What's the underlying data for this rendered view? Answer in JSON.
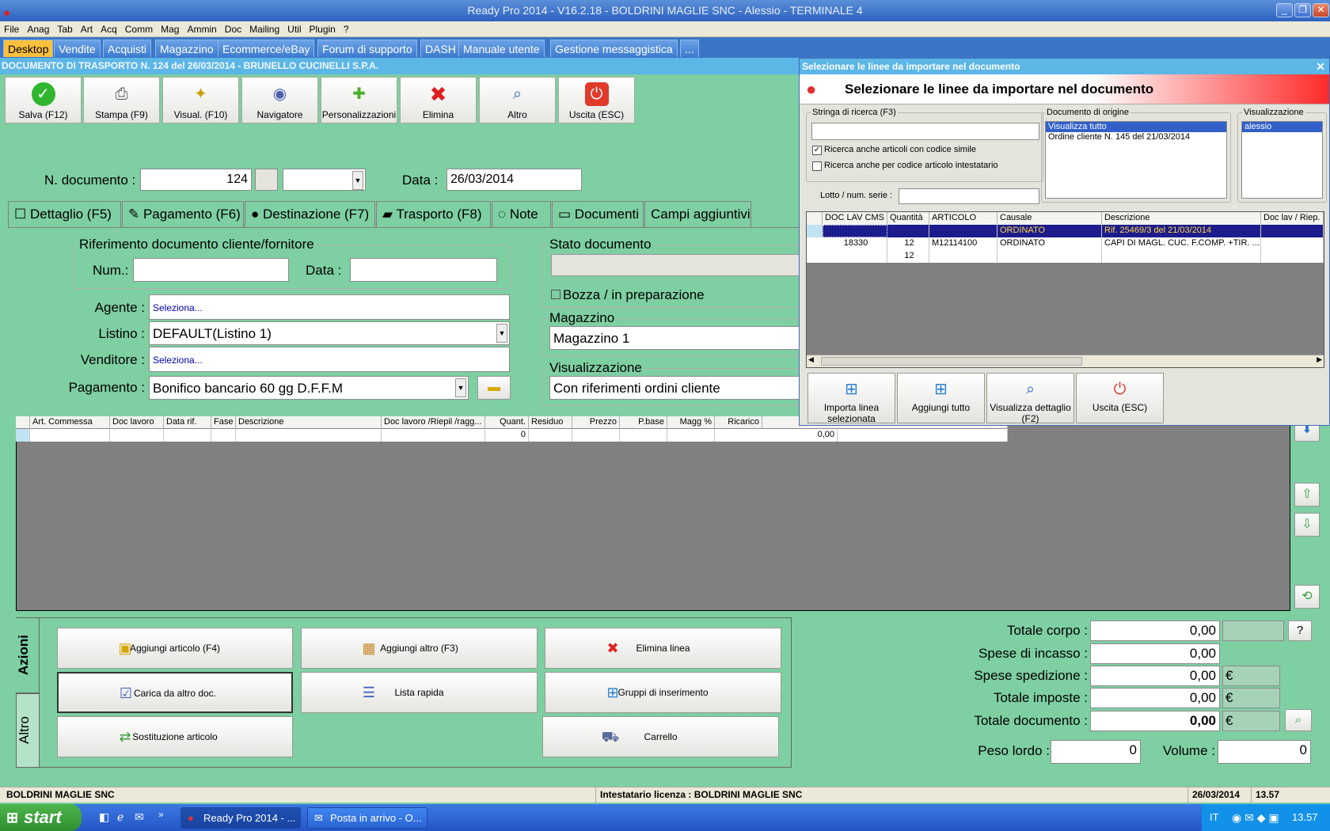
{
  "window": {
    "title": "Ready Pro 2014 - V16.2.18 - BOLDRINI MAGLIE SNC - Alessio - TERMINALE 4",
    "app_icon": "strawberry-icon"
  },
  "menu": [
    "File",
    "Anag",
    "Tab",
    "Art",
    "Acq",
    "Comm",
    "Mag",
    "Ammin",
    "Doc",
    "Mailing",
    "Util",
    "Plugin",
    "?"
  ],
  "main_tabs": [
    "Desktop",
    "Vendite",
    "Acquisti",
    "Magazzino",
    "Ecommerce/eBay",
    "Forum di supporto",
    "DASH",
    "Manuale utente",
    "Gestione messaggistica",
    "..."
  ],
  "active_main_tab": "Desktop",
  "doc_header": "DOCUMENTO DI TRASPORTO N. 124 del 26/03/2014 - BRUNELLO CUCINELLI S.P.A.",
  "toolbar": [
    {
      "label": "Salva (F12)",
      "icon": "checkmark-icon"
    },
    {
      "label": "Stampa (F9)",
      "icon": "printer-icon"
    },
    {
      "label": "Visual. (F10)",
      "icon": "magic-wand-icon"
    },
    {
      "label": "Navigatore",
      "icon": "compass-icon"
    },
    {
      "label": "Personalizzazioni",
      "icon": "puzzle-icon"
    },
    {
      "label": "Elimina",
      "icon": "delete-x-icon"
    },
    {
      "label": "Altro",
      "icon": "magnifier-icon"
    },
    {
      "label": "Uscita (ESC)",
      "icon": "power-icon"
    }
  ],
  "doc": {
    "number_label": "N. documento :",
    "number": "124",
    "date_label": "Data :",
    "date": "26/03/2014"
  },
  "detail_tabs": [
    "Dettaglio (F5)",
    "Pagamento (F6)",
    "Destinazione (F7)",
    "Trasporto (F8)",
    "Note",
    "Documenti",
    "Campi aggiuntivi"
  ],
  "rif": {
    "title": "Riferimento documento cliente/fornitore",
    "num_label": "Num.:",
    "data_label": "Data :"
  },
  "agente": {
    "label": "Agente :",
    "value": "Seleziona..."
  },
  "listino": {
    "label": "Listino :",
    "value": "DEFAULT(Listino 1)"
  },
  "venditore": {
    "label": "Venditore :",
    "value": "Seleziona..."
  },
  "pagamento": {
    "label": "Pagamento :",
    "value": "Bonifico bancario 60 gg D.F.F.M"
  },
  "stato": {
    "title": "Stato documento",
    "bozza": "Bozza / in preparazione"
  },
  "magazzino": {
    "title": "Magazzino",
    "value": "Magazzino 1"
  },
  "visualizzazione": {
    "title": "Visualizzazione",
    "value": "Con riferimenti ordini cliente"
  },
  "grid": {
    "columns": [
      "Art. Commessa",
      "Doc lavoro",
      "Data rif.",
      "Fase",
      "Descrizione",
      "Doc lavoro /Riepil /ragg...",
      "Quant.",
      "Residuo",
      "Prezzo",
      "P.base",
      "Magg %",
      "Ricarico"
    ],
    "row": {
      "quant": "0",
      "total": "0,00"
    }
  },
  "side_tabs": [
    "Azioni",
    "Altro"
  ],
  "actions": [
    {
      "label": "Aggiungi articolo (F4)",
      "icon": "add-box-icon"
    },
    {
      "label": "Aggiungi altro (F3)",
      "icon": "add-grid-icon"
    },
    {
      "label": "Elimina linea",
      "icon": "delete-x-icon"
    },
    {
      "label": "Carica da altro doc.",
      "icon": "checklist-icon"
    },
    {
      "label": "Lista rapida",
      "icon": "quick-list-icon"
    },
    {
      "label": "Gruppi di inserimento",
      "icon": "group-add-icon"
    },
    {
      "label": "Sostituzione articolo",
      "icon": "replace-icon"
    },
    {
      "label": "Carrello",
      "icon": "cart-icon"
    }
  ],
  "totals": {
    "corpo": {
      "label": "Totale corpo :",
      "value": "0,00"
    },
    "incasso": {
      "label": "Spese di incasso :",
      "value": "0,00"
    },
    "spedizione": {
      "label": "Spese spedizione :",
      "value": "0,00",
      "currency": "€"
    },
    "imposte": {
      "label": "Totale imposte :",
      "value": "0,00",
      "currency": "€"
    },
    "documento": {
      "label": "Totale documento :",
      "value": "0,00",
      "currency": "€"
    },
    "peso": {
      "label": "Peso lordo :",
      "value": "0"
    },
    "volume": {
      "label": "Volume :",
      "value": "0"
    },
    "help": "?"
  },
  "dialog": {
    "title": "Selezionare le linee da importare nel documento",
    "banner": "Selezionare le linee da importare nel documento",
    "search_label": "Stringa di ricerca (F3)",
    "chk1": "Ricerca anche articoli con codice simile",
    "chk2": "Ricerca anche per codice articolo intestatario",
    "lotto_label": "Lotto / num. serie :",
    "origine_title": "Documento di origine",
    "origine_items": [
      "Visualizza tutto",
      "Ordine cliente N. 145 del 21/03/2014"
    ],
    "vis_title": "Visualizzazione",
    "vis_items": [
      "alessio"
    ],
    "columns": [
      "DOC LAV CMS",
      "Quantità",
      "ARTICOLO",
      "Causale",
      "Descrizione",
      "Doc lav / Riep."
    ],
    "rows": [
      {
        "doc": "",
        "qty": "",
        "art": "",
        "causale": "ORDINATO",
        "desc": "Rif. 25469/3 del 21/03/2014"
      },
      {
        "doc": "18330",
        "qty": "12",
        "art": "M12114100",
        "causale": "ORDINATO",
        "desc": "CAPI DI MAGL. CUC. F.COMP. +TIR. ..."
      },
      {
        "doc": "",
        "qty": "12",
        "art": "",
        "causale": "",
        "desc": ""
      }
    ],
    "buttons": [
      {
        "label": "Importa linea selezionata",
        "icon": "import-line-icon"
      },
      {
        "label": "Aggiungi tutto",
        "icon": "add-all-icon"
      },
      {
        "label": "Visualizza dettaglio (F2)",
        "icon": "detail-view-icon"
      },
      {
        "label": "Uscita (ESC)",
        "icon": "power-icon"
      }
    ]
  },
  "status": {
    "company": "BOLDRINI MAGLIE SNC",
    "license": "Intestatario licenza : BOLDRINI MAGLIE SNC",
    "date": "26/03/2014",
    "time": "13.57"
  },
  "taskbar": {
    "start": "start",
    "tasks": [
      "Ready Pro 2014 - ...",
      "Posta in arrivo - O..."
    ],
    "lang": "IT",
    "clock": "13.57"
  }
}
